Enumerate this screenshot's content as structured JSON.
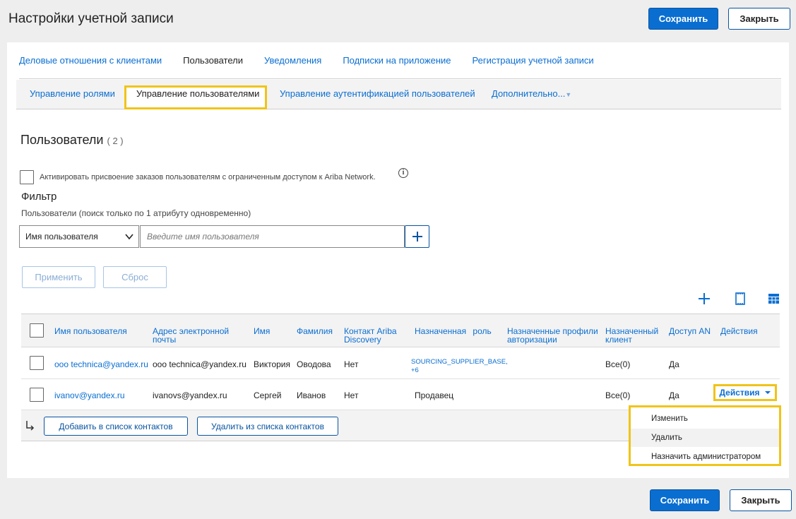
{
  "header": {
    "title": "Настройки учетной записи",
    "save_label": "Сохранить",
    "close_label": "Закрыть"
  },
  "tabs": [
    {
      "label": "Деловые отношения с клиентами",
      "active": false
    },
    {
      "label": "Пользователи",
      "active": true
    },
    {
      "label": "Уведомления",
      "active": false
    },
    {
      "label": "Подписки на приложение",
      "active": false
    },
    {
      "label": "Регистрация учетной записи",
      "active": false
    }
  ],
  "subtabs": [
    {
      "label": "Управление ролями",
      "active": false
    },
    {
      "label": "Управление пользователями",
      "active": true
    },
    {
      "label": "Управление аутентификацией пользователей",
      "active": false
    },
    {
      "label": "Дополнительно...",
      "active": false
    }
  ],
  "users_section": {
    "title": "Пользователи",
    "count": "( 2 )",
    "restricted_checkbox_label": "Активировать присвоение заказов пользователям с ограниченным доступом к Ariba Network.",
    "info_icon_glyph": "i"
  },
  "filter": {
    "title": "Фильтр",
    "subtitle": "Пользователи (поиск только по 1 атрибуту одновременно)",
    "attribute_selected": "Имя пользователя",
    "input_placeholder": "Введите имя пользователя",
    "apply_label": "Применить",
    "reset_label": "Сброс"
  },
  "table": {
    "columns": {
      "username": "Имя пользователя",
      "email": "Адрес электронной почты",
      "first_name": "Имя",
      "last_name": "Фамилия",
      "contact": "Контакт Ariba Discovery",
      "role": "Назначенная роль",
      "auth_profiles": "Назначенные профили авторизации",
      "client": "Назначенный клиент",
      "an_access": "Доступ AN",
      "actions": "Действия"
    },
    "rows": [
      {
        "username": "ooo technica@yandex.ru",
        "email": "ooo technica@yandex.ru",
        "first_name": "Виктория",
        "last_name": "Оводова",
        "contact": "Нет",
        "role_link": "SOURCING_SUPPLIER_BASE, +6",
        "client": "Все(0)",
        "an_access": "Да"
      },
      {
        "username": "ivanov@yandex.ru",
        "email": "ivanovs@yandex.ru",
        "first_name": "Сергей",
        "last_name": "Иванов",
        "contact": "Нет",
        "role": "Продавец",
        "client": "Все(0)",
        "an_access": "Да",
        "actions_label": "Действия"
      }
    ],
    "footer": {
      "add_contacts_label": "Добавить в список контактов",
      "remove_contacts_label": "Удалить из списка контактов"
    }
  },
  "actions_menu": [
    {
      "label": "Изменить",
      "hover": false
    },
    {
      "label": "Удалить",
      "hover": true
    },
    {
      "label": "Назначить администратором",
      "hover": false
    }
  ],
  "colors": {
    "primary": "#0a6ed1",
    "highlight": "#f0c419"
  }
}
